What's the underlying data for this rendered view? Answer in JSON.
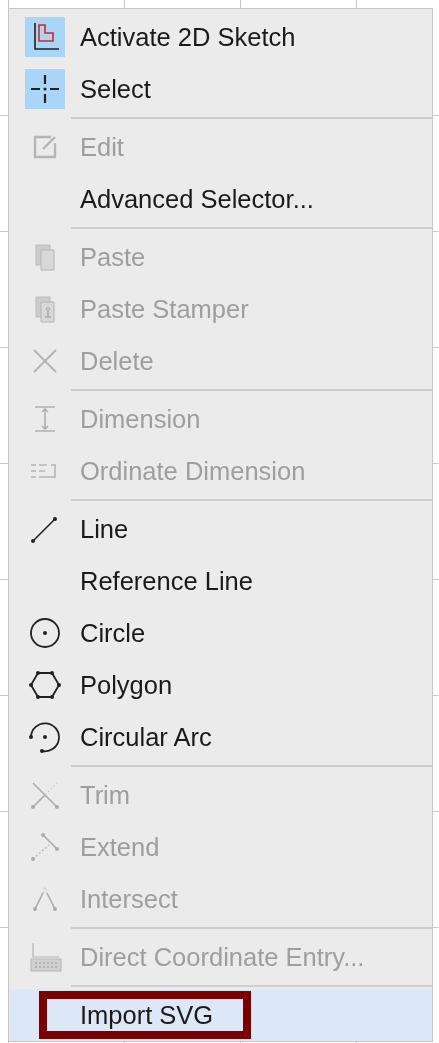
{
  "menu": {
    "groups": [
      {
        "items": [
          {
            "label": "Activate 2D Sketch",
            "kind": "sketch",
            "checked": true,
            "disabled": false,
            "selected": false
          },
          {
            "label": "Select",
            "kind": "select",
            "checked": true,
            "disabled": false,
            "selected": false
          }
        ]
      },
      {
        "items": [
          {
            "label": "Edit",
            "kind": "edit",
            "checked": false,
            "disabled": true,
            "selected": false
          },
          {
            "label": "Advanced Selector...",
            "checked": false,
            "disabled": false,
            "selected": false
          }
        ]
      },
      {
        "items": [
          {
            "label": "Paste",
            "kind": "paste",
            "checked": false,
            "disabled": true,
            "selected": false
          },
          {
            "label": "Paste Stamper",
            "kind": "stamper",
            "checked": false,
            "disabled": true,
            "selected": false
          },
          {
            "label": "Delete",
            "kind": "delete",
            "checked": false,
            "disabled": true,
            "selected": false
          }
        ]
      },
      {
        "items": [
          {
            "label": "Dimension",
            "kind": "dimension",
            "checked": false,
            "disabled": true,
            "selected": false
          },
          {
            "label": "Ordinate Dimension",
            "kind": "ordinate",
            "checked": false,
            "disabled": true,
            "selected": false
          }
        ]
      },
      {
        "items": [
          {
            "label": "Line",
            "kind": "line",
            "checked": false,
            "disabled": false,
            "selected": false
          },
          {
            "label": "Reference Line",
            "checked": false,
            "disabled": false,
            "selected": false
          },
          {
            "label": "Circle",
            "kind": "circle",
            "checked": false,
            "disabled": false,
            "selected": false
          },
          {
            "label": "Polygon",
            "kind": "polygon",
            "checked": false,
            "disabled": false,
            "selected": false
          },
          {
            "label": "Circular Arc",
            "kind": "arc",
            "checked": false,
            "disabled": false,
            "selected": false
          }
        ]
      },
      {
        "items": [
          {
            "label": "Trim",
            "kind": "trim",
            "checked": false,
            "disabled": true,
            "selected": false
          },
          {
            "label": "Extend",
            "kind": "extend",
            "checked": false,
            "disabled": true,
            "selected": false
          },
          {
            "label": "Intersect",
            "kind": "intersect",
            "checked": false,
            "disabled": true,
            "selected": false
          }
        ]
      },
      {
        "items": [
          {
            "label": "Direct Coordinate Entry...",
            "kind": "keyboard",
            "checked": false,
            "disabled": true,
            "selected": false
          }
        ]
      },
      {
        "items": [
          {
            "label": "Import SVG",
            "checked": false,
            "disabled": false,
            "selected": true,
            "outlined": true
          }
        ]
      }
    ]
  }
}
